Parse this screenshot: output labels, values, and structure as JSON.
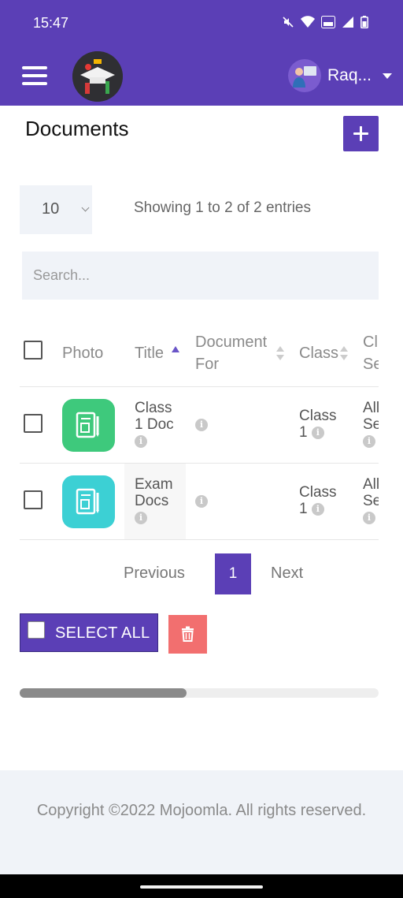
{
  "status_bar": {
    "time": "15:47"
  },
  "header": {
    "user_name": "Raq..."
  },
  "page": {
    "title": "Documents"
  },
  "table_controls": {
    "page_length": "10",
    "info": "Showing 1 to 2 of 2 entries",
    "search_placeholder": "Search..."
  },
  "table": {
    "columns": {
      "photo": "Photo",
      "title": "Title",
      "document_for_1": "Document",
      "document_for_2": "For",
      "class": "Class",
      "section_1": "Cl",
      "section_2": "Se"
    },
    "rows": [
      {
        "title_1": "Class",
        "title_2": "1 Doc",
        "class_1": "Class",
        "class_2": "1",
        "section_1": "All",
        "section_2": "Se",
        "photo_color": "#3ec97c"
      },
      {
        "title_1": "Exam",
        "title_2": "Docs",
        "class_1": "Class",
        "class_2": "1",
        "section_1": "All",
        "section_2": "Se",
        "photo_color": "#3cd0d4"
      }
    ]
  },
  "pagination": {
    "previous": "Previous",
    "current": "1",
    "next": "Next"
  },
  "actions": {
    "select_all": "SELECT ALL"
  },
  "footer": {
    "copyright": "Copyright ©2022 Mojoomla. All rights reserved."
  },
  "colors": {
    "brand": "#5b3fb6",
    "danger": "#f26f6f",
    "surface": "#f0f3f8"
  }
}
